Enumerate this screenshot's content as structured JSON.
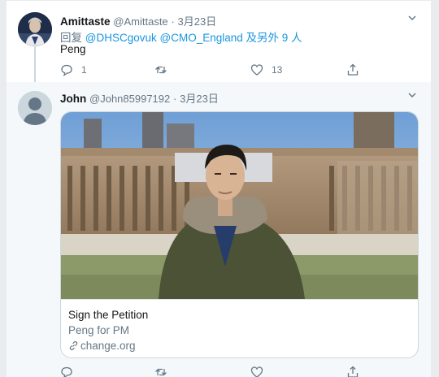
{
  "tweets": [
    {
      "name": "Amittaste",
      "handle": "@Amittaste",
      "separator": "·",
      "date": "3月23日",
      "reply_prefix": "回复",
      "reply_mentions": "@DHSCgovuk @CMO_England",
      "reply_suffix": "及另外 9 人",
      "text": "Peng",
      "reply_count": "1",
      "retweet_count": "",
      "like_count": "13"
    },
    {
      "name": "John",
      "handle": "@John85997192",
      "separator": "·",
      "date": "3月23日",
      "card": {
        "title": "Sign the Petition",
        "description": "Peng for PM",
        "domain": "change.org"
      }
    }
  ],
  "icons": {
    "reply": "reply-icon",
    "retweet": "retweet-icon",
    "like": "heart-icon",
    "share": "share-icon",
    "more": "chevron-down-icon",
    "link": "link-icon"
  },
  "colors": {
    "link_blue": "#1b95e0",
    "secondary_text": "#657786",
    "hover_background": "#f5f8fa"
  }
}
